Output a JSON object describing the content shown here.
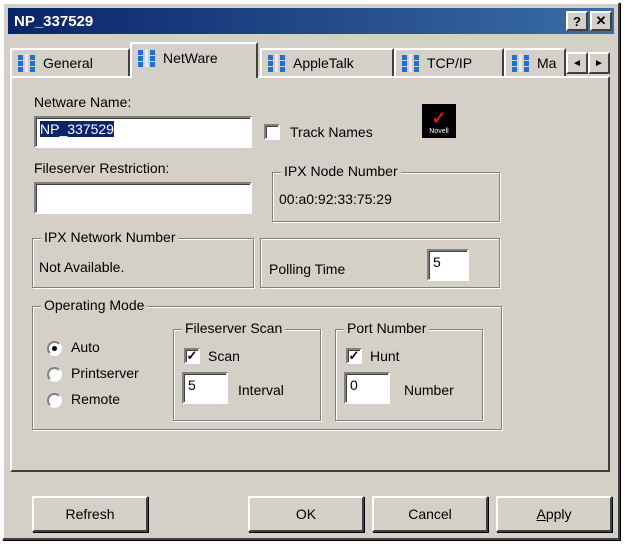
{
  "window": {
    "title": "NP_337529",
    "help_label": "?",
    "close_label": "✕"
  },
  "tabs": [
    {
      "label": "General"
    },
    {
      "label": "NetWare"
    },
    {
      "label": "AppleTalk"
    },
    {
      "label": "TCP/IP"
    },
    {
      "label": "Ma"
    }
  ],
  "tab_scroll": {
    "left": "◄",
    "right": "►"
  },
  "netware": {
    "name_label": "Netware Name:",
    "name_value": "NP_337529",
    "track_names_label": "Track Names",
    "track_names_checked": false,
    "logo_text": "Novell",
    "fileserver_restriction_label": "Fileserver Restriction:",
    "fileserver_restriction_value": "",
    "ipx_node_title": "IPX Node Number",
    "ipx_node_value": "00:a0:92:33:75:29",
    "ipx_network_title": "IPX Network Number",
    "ipx_network_value": "Not Available.",
    "polling_label": "Polling Time",
    "polling_value": "5",
    "operating_mode": {
      "title": "Operating Mode",
      "options": [
        "Auto",
        "Printserver",
        "Remote"
      ],
      "selected": "Auto"
    },
    "fileserver_scan": {
      "title": "Fileserver Scan",
      "scan_label": "Scan",
      "scan_checked": true,
      "interval_value": "5",
      "interval_label": "Interval"
    },
    "port_number": {
      "title": "Port Number",
      "hunt_label": "Hunt",
      "hunt_checked": true,
      "number_value": "0",
      "number_label": "Number"
    }
  },
  "buttons": {
    "refresh": "Refresh",
    "ok": "OK",
    "cancel": "Cancel",
    "apply_underlined": "A",
    "apply_rest": "pply"
  }
}
